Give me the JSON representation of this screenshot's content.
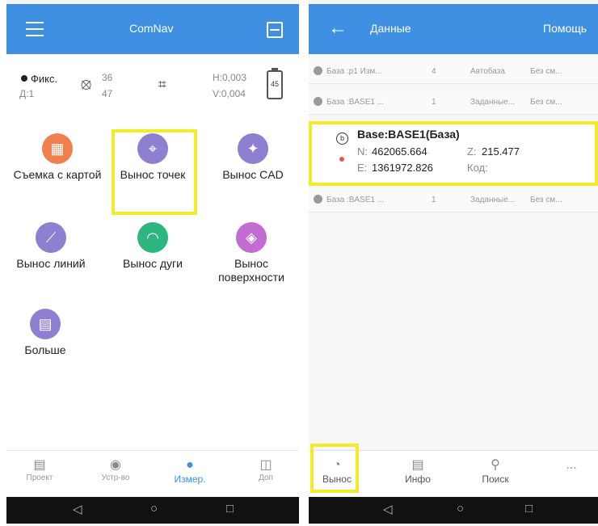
{
  "left": {
    "app_title": "ComNav",
    "status": {
      "fix_label": "Фикс.",
      "age_label": "Д:1",
      "sat_top": "36",
      "sat_bottom": "47",
      "h_precision": "H:0,003",
      "v_precision": "V:0,004",
      "battery": "45"
    },
    "apps": [
      {
        "label": "Съемка с картой",
        "color": "#ef7f4d",
        "icon": "map-icon"
      },
      {
        "label": "Вынос точек",
        "color": "#8e7fd0",
        "icon": "stakeout-point-icon"
      },
      {
        "label": "Вынос CAD",
        "color": "#8e7fd0",
        "icon": "cad-icon"
      },
      {
        "label": "Вынос линий",
        "color": "#8e7fd0",
        "icon": "stakeout-line-icon"
      },
      {
        "label": "Вынос дуги",
        "color": "#2fb57f",
        "icon": "stakeout-arc-icon"
      },
      {
        "label": "Вынос поверхности",
        "color": "#c16bd3",
        "icon": "surface-icon"
      },
      {
        "label": "Больше",
        "color": "#8e7fd0",
        "icon": "more-grid-icon"
      }
    ],
    "tabs": [
      {
        "label": "Проект",
        "icon": "project-icon"
      },
      {
        "label": "Устр-во",
        "icon": "device-icon"
      },
      {
        "label": "Измер.",
        "icon": "measure-icon"
      },
      {
        "label": "Доп",
        "icon": "tools-icon"
      }
    ],
    "active_tab": "Измер."
  },
  "right": {
    "title": "Данные",
    "help": "Помощь",
    "rows": [
      {
        "name": "База :р1 Изм...",
        "num": "4",
        "type": "Автобаза",
        "offset": "Без см..."
      },
      {
        "name": "База :BASE1 ...",
        "num": "1",
        "type": "Заданные...",
        "offset": "Без см..."
      },
      {
        "name": "База :BASE1 ...",
        "num": "1",
        "type": "Заданные...",
        "offset": "Без см..."
      }
    ],
    "card": {
      "title": "Base:BASE1(База)",
      "badge": "b",
      "n_label": "N:",
      "n_value": "462065.664",
      "z_label": "Z:",
      "z_value": "215.477",
      "e_label": "E:",
      "e_value": "1361972.826",
      "code_label": "Код:"
    },
    "tabs": [
      {
        "label": "Вынос",
        "icon": "stakeout-icon"
      },
      {
        "label": "Инфо",
        "icon": "info-icon"
      },
      {
        "label": "Поиск",
        "icon": "search-icon"
      },
      {
        "label": "...",
        "icon": "more-icon"
      }
    ]
  },
  "colors": {
    "topbar": "#3f8fe3",
    "highlight": "#f2ea2b",
    "active_tab": "#3f8fe3"
  }
}
